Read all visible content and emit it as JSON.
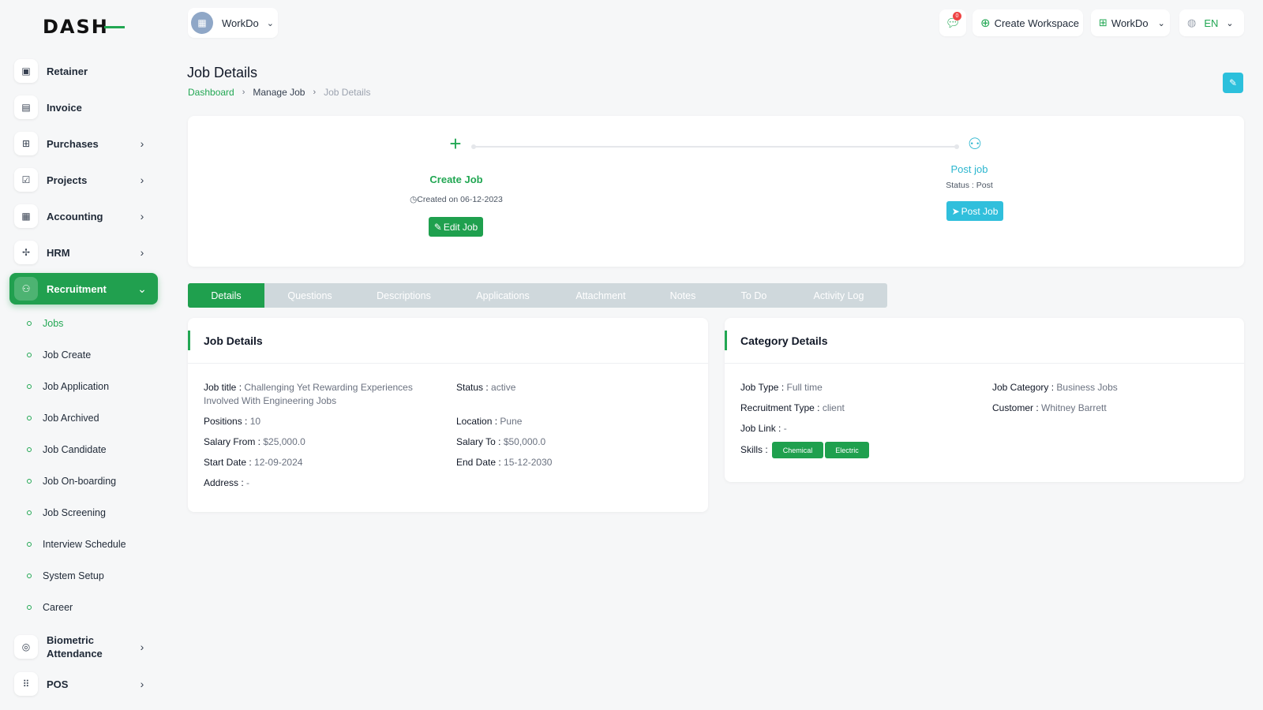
{
  "logo": {
    "text": "DASH"
  },
  "sidebar": {
    "items": [
      {
        "label": "Retainer",
        "icon": "retainer-icon",
        "glyph": "▣",
        "has_chevron": false
      },
      {
        "label": "Invoice",
        "icon": "invoice-icon",
        "glyph": "▤",
        "has_chevron": false
      },
      {
        "label": "Purchases",
        "icon": "cart-icon",
        "glyph": "🛒",
        "has_chevron": true
      },
      {
        "label": "Projects",
        "icon": "projects-icon",
        "glyph": "☑",
        "has_chevron": true
      },
      {
        "label": "Accounting",
        "icon": "grid-icon",
        "glyph": "▦",
        "has_chevron": true
      },
      {
        "label": "HRM",
        "icon": "hrm-icon",
        "glyph": "✢",
        "has_chevron": true
      },
      {
        "label": "Recruitment",
        "icon": "user-plus-icon",
        "glyph": "👤",
        "has_chevron": true,
        "active": true
      }
    ],
    "sub_items": [
      {
        "label": "Jobs",
        "active": true
      },
      {
        "label": "Job Create"
      },
      {
        "label": "Job Application"
      },
      {
        "label": "Job Archived"
      },
      {
        "label": "Job Candidate"
      },
      {
        "label": "Job On-boarding"
      },
      {
        "label": "Job Screening"
      },
      {
        "label": "Interview Schedule"
      },
      {
        "label": "System Setup"
      },
      {
        "label": "Career"
      }
    ],
    "bottom_items": [
      {
        "label": "Biometric Attendance",
        "icon": "fingerprint-icon",
        "glyph": "◎"
      },
      {
        "label": "POS",
        "icon": "pos-grid-icon",
        "glyph": "⠿"
      }
    ]
  },
  "header": {
    "workspace": "WorkDo",
    "chat_badge": "0",
    "create_workspace": "Create Workspace",
    "workdo_menu": "WorkDo",
    "language": "EN"
  },
  "page": {
    "title": "Job Details",
    "breadcrumb": [
      "Dashboard",
      "Manage Job",
      "Job Details"
    ]
  },
  "steps": {
    "create": {
      "title": "Create Job",
      "sub": "Created on 06-12-2023",
      "button": "Edit Job"
    },
    "post": {
      "title": "Post job",
      "sub": "Status : Post",
      "button": "Post Job"
    }
  },
  "tabs": [
    "Details",
    "Questions",
    "Descriptions",
    "Applications",
    "Attachment",
    "Notes",
    "To Do",
    "Activity Log"
  ],
  "job_details": {
    "title": "Job Details",
    "fields": {
      "job_title": {
        "label": "Job title :",
        "value": "Challenging Yet Rewarding Experiences Involved With Engineering Jobs"
      },
      "status": {
        "label": "Status :",
        "value": "active"
      },
      "positions": {
        "label": "Positions :",
        "value": "10"
      },
      "location": {
        "label": "Location :",
        "value": "Pune"
      },
      "salary_from": {
        "label": "Salary From :",
        "value": "$25,000.0"
      },
      "salary_to": {
        "label": "Salary To :",
        "value": "$50,000.0"
      },
      "start_date": {
        "label": "Start Date :",
        "value": "12-09-2024"
      },
      "end_date": {
        "label": "End Date :",
        "value": "15-12-2030"
      },
      "address": {
        "label": "Address :",
        "value": "-"
      }
    }
  },
  "category_details": {
    "title": "Category Details",
    "fields": {
      "job_type": {
        "label": "Job Type :",
        "value": "Full time"
      },
      "job_category": {
        "label": "Job Category :",
        "value": "Business Jobs"
      },
      "recruitment_type": {
        "label": "Recruitment Type :",
        "value": "client"
      },
      "customer": {
        "label": "Customer :",
        "value": "Whitney Barrett"
      },
      "job_link": {
        "label": "Job Link :",
        "value": "-"
      },
      "skills": {
        "label": "Skills :",
        "values": [
          "Chemical",
          "Electric"
        ]
      }
    }
  },
  "colors": {
    "brand": "#22a753",
    "accent": "#2cb6cf",
    "tab_inactive": "#cfd8dc"
  }
}
